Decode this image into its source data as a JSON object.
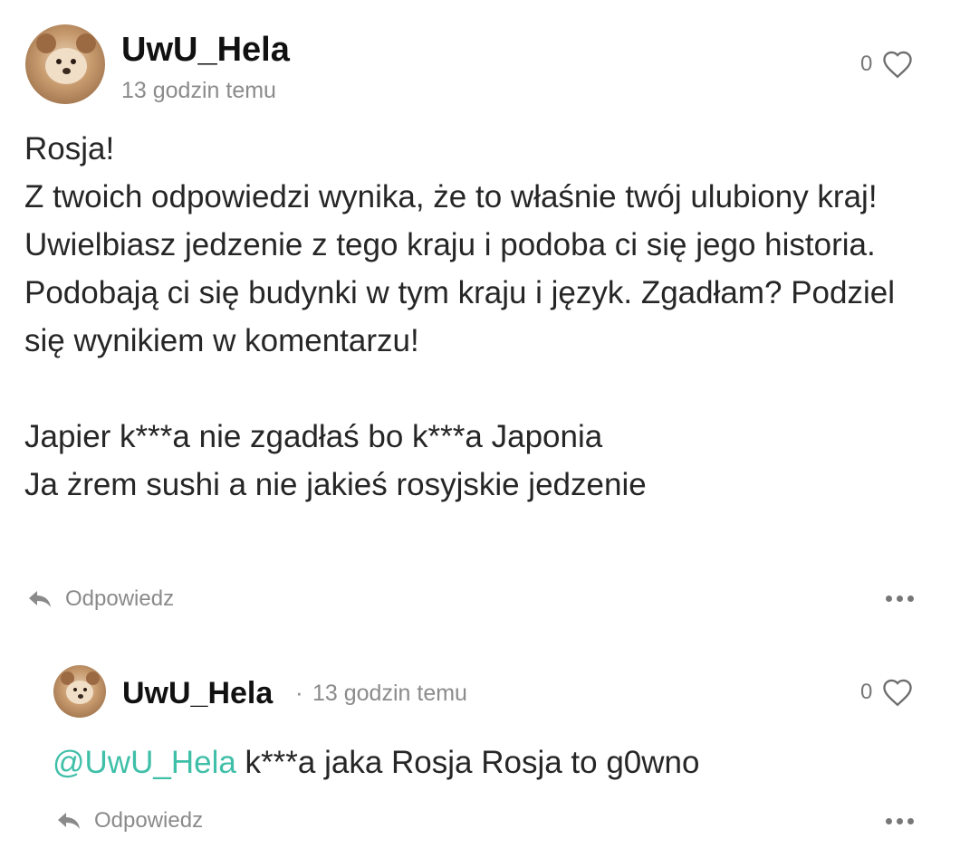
{
  "comment": {
    "username": "UwU_Hela",
    "time": "13 godzin temu",
    "like_count": "0",
    "text": "Rosja!\nZ twoich odpowiedzi wynika, że to właśnie twój ulubiony kraj! Uwielbiasz jedzenie z tego kraju i podoba ci się jego historia. Podobają ci się budynki w tym kraju i język. Zgadłam? Podziel się wynikiem w komentarzu!\n\nJapier k***a nie zgadłaś bo k***a Japonia\nJa żrem sushi a nie jakieś rosyjskie jedzenie",
    "reply_label": "Odpowiedz",
    "more_icon": "more-horizontal-icon"
  },
  "reply": {
    "username": "UwU_Hela",
    "separator": "·",
    "time": "13 godzin temu",
    "like_count": "0",
    "mention": "@UwU_Hela",
    "text": " k***a jaka Rosja Rosja to g0wno",
    "reply_label": "Odpowiedz",
    "more_icon": "more-horizontal-icon"
  },
  "colors": {
    "mention": "#3fbfa8",
    "username": "#111111",
    "muted": "#8b8b8b"
  }
}
